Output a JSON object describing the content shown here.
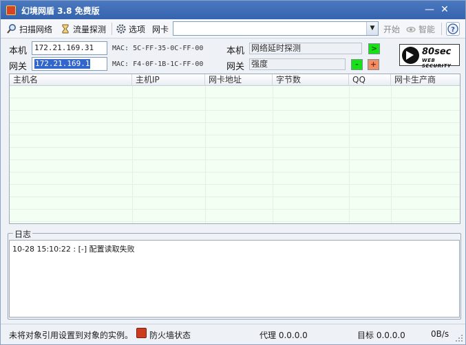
{
  "window": {
    "title": "幻境网盾 3.8 免费版",
    "minimize_glyph": "—",
    "close_glyph": "✕"
  },
  "toolbar": {
    "scan_label": "扫描网络",
    "traffic_label": "流量探测",
    "options_label": "选项",
    "nic_label": "网卡",
    "nic_value": "",
    "start_label": "开始",
    "smart_label": "智能",
    "help_glyph": "?"
  },
  "host": {
    "label": "本机",
    "ip": "172.21.169.31",
    "mac": "MAC: 5C-FF-35-0C-FF-00",
    "right_label": "本机",
    "probe_text": "网络延时探测",
    "go_glyph": ">"
  },
  "gateway": {
    "label": "网关",
    "ip": "172.21.169.1",
    "mac": "MAC: F4-0F-1B-1C-FF-00",
    "right_label": "网关",
    "strength_text": "强度",
    "minus_glyph": "-",
    "plus_glyph": "+"
  },
  "logo": {
    "brand": "80sec",
    "sub": "WEB SECURITY"
  },
  "table": {
    "columns": [
      "主机名",
      "主机IP",
      "网卡地址",
      "字节数",
      "QQ",
      "网卡生产商"
    ],
    "rows": []
  },
  "log": {
    "title": "日志",
    "lines": [
      "10-28 15:10:22 : [-] 配置读取失败"
    ]
  },
  "status": {
    "message": "未将对象引用设置到对象的实例。",
    "firewall_label": "防火墙状态",
    "proxy_label": "代理 0.0.0.0",
    "target_label": "目标 0.0.0.0",
    "rate_label": "0B/s"
  },
  "colors": {
    "titlebar": "#3c6ab4",
    "table_bg": "#f2fff2",
    "go_green": "#16e016",
    "plus_orange": "#f28e66"
  }
}
